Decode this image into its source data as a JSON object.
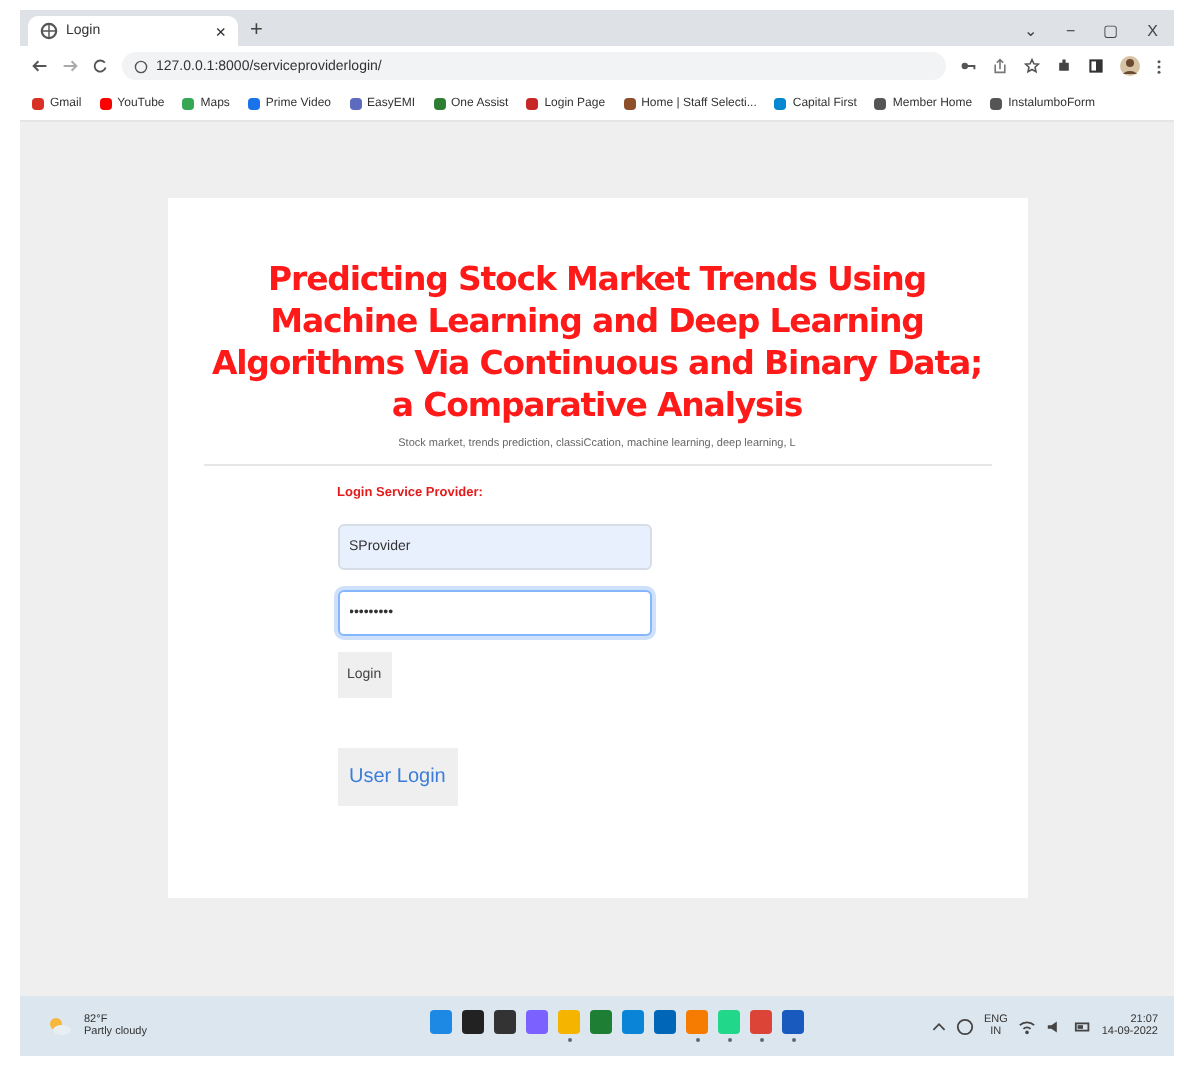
{
  "browser": {
    "tab": {
      "title": "Login",
      "close": "×"
    },
    "new_tab": "+",
    "window_controls": [
      "⌄",
      "−",
      "▢",
      "X"
    ],
    "url": "127.0.0.1:8000/serviceproviderlogin/",
    "bookmarks": [
      {
        "label": "Gmail",
        "color": "#d93025"
      },
      {
        "label": "YouTube",
        "color": "#ff0000"
      },
      {
        "label": "Maps",
        "color": "#34a853"
      },
      {
        "label": "Prime Video",
        "color": "#1a73e8"
      },
      {
        "label": "EasyEMI",
        "color": "#5c6bc0"
      },
      {
        "label": "One Assist",
        "color": "#2e7d32"
      },
      {
        "label": "Login Page",
        "color": "#c62828"
      },
      {
        "label": "Home | Staff Selecti...",
        "color": "#8d4e2a"
      },
      {
        "label": "Capital First",
        "color": "#0288d1"
      },
      {
        "label": "Member Home",
        "color": "#555555"
      },
      {
        "label": "InstalumboForm",
        "color": "#555555"
      }
    ]
  },
  "page": {
    "title": "Predicting Stock Market Trends Using Machine Learning and Deep Learning Algorithms Via Continuous and Binary Data; a Comparative Analysis",
    "subtitle": "Stock market, trends prediction, classiCcation, machine learning, deep learning, L",
    "form": {
      "heading": "Login Service Provider:",
      "username": {
        "value": "SProvider"
      },
      "password": {
        "value": "•••••••••",
        "focused": true
      },
      "login_button": "Login",
      "user_login_button": "User Login"
    }
  },
  "taskbar": {
    "weather": {
      "temp": "82°F",
      "condition": "Partly cloudy"
    },
    "apps": [
      {
        "color": "#1e88e5",
        "running": false
      },
      {
        "color": "#222222",
        "running": false
      },
      {
        "color": "#333333",
        "running": false
      },
      {
        "color": "#7b61ff",
        "running": false
      },
      {
        "color": "#f4b400",
        "running": true
      },
      {
        "color": "#1e7e34",
        "running": false
      },
      {
        "color": "#0a84d6",
        "running": false
      },
      {
        "color": "#0067b8",
        "running": false
      },
      {
        "color": "#f57c00",
        "running": true
      },
      {
        "color": "#21d789",
        "running": true
      },
      {
        "color": "#db4437",
        "running": true
      },
      {
        "color": "#185abd",
        "running": true
      }
    ],
    "language": "ENG",
    "region": "IN",
    "time": "21:07",
    "date": "14-09-2022"
  }
}
